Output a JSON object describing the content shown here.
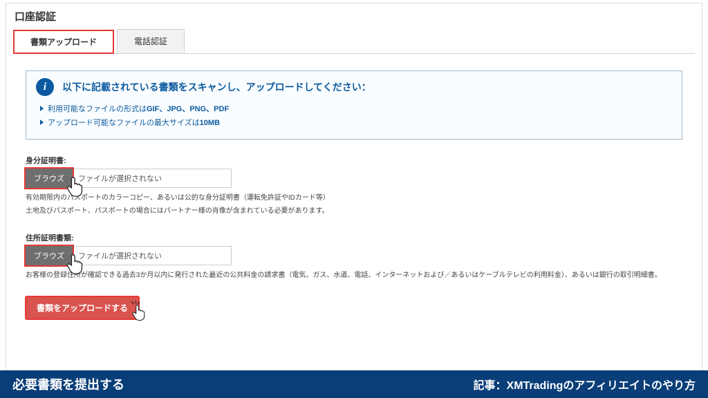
{
  "page": {
    "title": "口座認証"
  },
  "tabs": {
    "upload": "書類アップロード",
    "phone": "電話認証"
  },
  "info": {
    "title": "以下に記載されている書類をスキャンし、アップロードしてください：",
    "line1_pre": "利用可能なファイルの形式は",
    "line1_bold": "GIF、JPG、PNG、PDF",
    "line2_pre": "アップロード可能なファイルの最大サイズは",
    "line2_bold": "10MB"
  },
  "id_doc": {
    "label": "身分証明書:",
    "browse": "ブラウズ",
    "no_file": "ファイルが選択されない",
    "help1": "有効期限内のパスポートのカラーコピー、あるいは公的な身分証明書（運転免許証やIDカード等）",
    "help2": "土地及びパスポート、パスポートの場合にはパートナー様の肖像が含まれている必要があります。"
  },
  "addr_doc": {
    "label": "住所証明書類:",
    "browse": "ブラウズ",
    "no_file": "ファイルが選択されない",
    "help": "お客様の登録住所が確認できる過去3か月以内に発行された最近の公共料金の請求書（電気、ガス、水道、電話、インターネットおよび／あるいはケーブルテレビの利用料金）、あるいは銀行の取引明細書。"
  },
  "submit": {
    "label": "書類をアップロードする"
  },
  "banner": {
    "left": "必要書類を提出する",
    "right": "記事：XMTradingのアフィリエイトのやり方"
  }
}
